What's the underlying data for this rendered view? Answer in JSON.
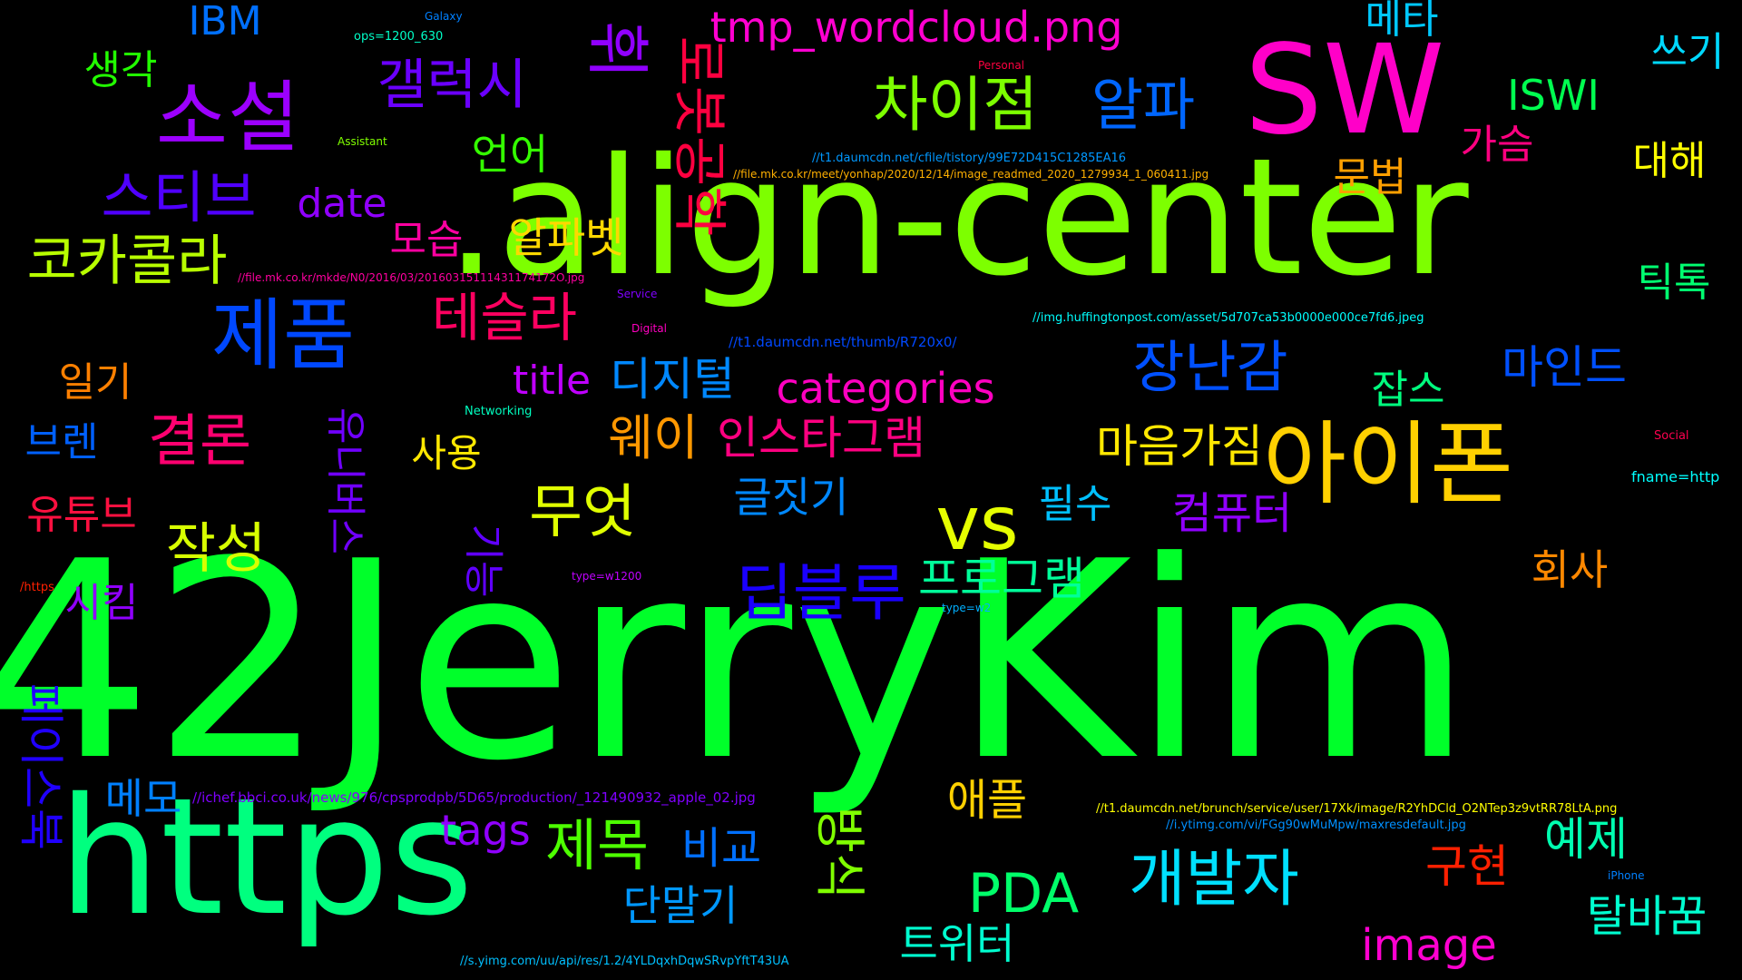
{
  "words": [
    {
      "text": "42JerryKim",
      "color": "#00ff2a"
    },
    {
      "text": ".align-center",
      "color": "#7dff00"
    },
    {
      "text": "https",
      "color": "#00ff7f"
    },
    {
      "text": "SW",
      "color": "#ff00c8"
    },
    {
      "text": "소설",
      "color": "#9c00ff"
    },
    {
      "text": "아이폰",
      "color": "#ffd000"
    },
    {
      "text": "제품",
      "color": "#0048ff"
    },
    {
      "text": "차이점",
      "color": "#7dff00"
    },
    {
      "text": "vs",
      "color": "#e6ff00"
    },
    {
      "text": "갤럭시",
      "color": "#6a00ff"
    },
    {
      "text": "tmp_wordcloud.png",
      "color": "#ff00d0"
    },
    {
      "text": "알파",
      "color": "#0066ff"
    },
    {
      "text": "스티브",
      "color": "#5000ff"
    },
    {
      "text": "테슬라",
      "color": "#ff0060"
    },
    {
      "text": "장난감",
      "color": "#0050ff"
    },
    {
      "text": "코카콜라",
      "color": "#b8ff00"
    },
    {
      "text": "개발자",
      "color": "#00e0ff"
    },
    {
      "text": "딥블루",
      "color": "#1a00ff"
    },
    {
      "text": "무엇",
      "color": "#e0ff00"
    },
    {
      "text": "제목",
      "color": "#4dff00"
    },
    {
      "text": "PDA",
      "color": "#00ff6a"
    },
    {
      "text": "결론",
      "color": "#ff0070"
    },
    {
      "text": "작성",
      "color": "#d8ff00"
    },
    {
      "text": "웨이",
      "color": "#ff9800"
    },
    {
      "text": "인스타그램",
      "color": "#ff0080"
    },
    {
      "text": "categories",
      "color": "#ff00c0"
    },
    {
      "text": "디지털",
      "color": "#0088ff"
    },
    {
      "text": "title",
      "color": "#c000ff"
    },
    {
      "text": "date",
      "color": "#9000ff"
    },
    {
      "text": "IBM",
      "color": "#0070ff"
    },
    {
      "text": "생각",
      "color": "#22ff00"
    },
    {
      "text": "언어",
      "color": "#34ff00"
    },
    {
      "text": "모습",
      "color": "#ff00a0"
    },
    {
      "text": "알파벳",
      "color": "#ffd800"
    },
    {
      "text": "마인드",
      "color": "#0050ff"
    },
    {
      "text": "잡스",
      "color": "#00ff7f"
    },
    {
      "text": "마음가짐",
      "color": "#ffe800"
    },
    {
      "text": "컴퓨터",
      "color": "#9000ff"
    },
    {
      "text": "필수",
      "color": "#00c0ff"
    },
    {
      "text": "글짓기",
      "color": "#0088ff"
    },
    {
      "text": "사용",
      "color": "#ffe800"
    },
    {
      "text": "프로그램",
      "color": "#00ff9a"
    },
    {
      "text": "회사",
      "color": "#ff8800"
    },
    {
      "text": "애플",
      "color": "#ffd000"
    },
    {
      "text": "image",
      "color": "#ff00d0"
    },
    {
      "text": "구현",
      "color": "#ff2000"
    },
    {
      "text": "예제",
      "color": "#00ffb0"
    },
    {
      "text": "탈바꿈",
      "color": "#00ffd0"
    },
    {
      "text": "트위터",
      "color": "#00ffd0"
    },
    {
      "text": "단말기",
      "color": "#0098ff"
    },
    {
      "text": "비교",
      "color": "#0070ff"
    },
    {
      "text": "tags",
      "color": "#9000ff"
    },
    {
      "text": "메모",
      "color": "#0080ff"
    },
    {
      "text": "메타",
      "color": "#00c8ff"
    },
    {
      "text": "쓰기",
      "color": "#00d8ff"
    },
    {
      "text": "ISWI",
      "color": "#00ff50"
    },
    {
      "text": "가슴",
      "color": "#ff0080"
    },
    {
      "text": "문법",
      "color": "#ffa000"
    },
    {
      "text": "대해",
      "color": "#ffff00"
    },
    {
      "text": "틱톡",
      "color": "#00ff70"
    },
    {
      "text": "일기",
      "color": "#ff8000"
    },
    {
      "text": "브렌",
      "color": "#0060ff"
    },
    {
      "text": "유튜브",
      "color": "#ff1040"
    },
    {
      "text": "시킴",
      "color": "#9000ff"
    },
    {
      "text": "휘",
      "color": "#9000ff"
    },
    {
      "text": "로봇공학",
      "color": "#ff0040"
    },
    {
      "text": "유니버스",
      "color": "#7000ff"
    },
    {
      "text": "기능",
      "color": "#6000ff"
    },
    {
      "text": "페이스북",
      "color": "#2000ff"
    },
    {
      "text": "방식",
      "color": "#80ff00"
    },
    {
      "text": "ops=1200_630",
      "color": "#00ffc8"
    },
    {
      "text": "Galaxy",
      "color": "#0080ff"
    },
    {
      "text": "Personal",
      "color": "#ff0040"
    },
    {
      "text": "Assistant",
      "color": "#80ff00"
    },
    {
      "text": "//t1.daumcdn.net/cfile/tistory/99E72D415C1285EA16",
      "color": "#0098ff"
    },
    {
      "text": "//file.mk.co.kr/meet/yonhap/2020/12/14/image_readmed_2020_1279934_1_060411.jpg",
      "color": "#ffb000"
    },
    {
      "text": "//file.mk.co.kr/mkde/N0/2016/03/20160315111431174172O.jpg",
      "color": "#ff00a0"
    },
    {
      "text": "Service",
      "color": "#8000ff"
    },
    {
      "text": "//img.huffingtonpost.com/asset/5d707ca53b0000e000ce7fd6.jpeg",
      "color": "#00ffff"
    },
    {
      "text": "Digital",
      "color": "#ff00c0"
    },
    {
      "text": "//t1.daumcdn.net/thumb/R720x0/",
      "color": "#0048ff"
    },
    {
      "text": "Networking",
      "color": "#00ffc0"
    },
    {
      "text": "Social",
      "color": "#ff0050"
    },
    {
      "text": "fname=http",
      "color": "#00ffff"
    },
    {
      "text": "/https",
      "color": "#ff2000"
    },
    {
      "text": "type=w1200",
      "color": "#c000ff"
    },
    {
      "text": "type=w2",
      "color": "#00b0ff"
    },
    {
      "text": "//ichef.bbci.co.uk/news/976/cpsprodpb/5D65/production/_121490932_apple_02.jpg",
      "color": "#8000ff"
    },
    {
      "text": "//t1.daumcdn.net/brunch/service/user/17Xk/image/R2YhDCld_O2NTep3z9vtRR78LtA.png",
      "color": "#ffff00"
    },
    {
      "text": "//i.ytimg.com/vi/FGg90wMuMpw/maxresdefault.jpg",
      "color": "#0090ff"
    },
    {
      "text": "iPhone",
      "color": "#0080ff"
    },
    {
      "text": "//s.yimg.com/uu/api/res/1.2/4YLDqxhDqwSRvpYftT43UA",
      "color": "#00c0ff"
    }
  ]
}
